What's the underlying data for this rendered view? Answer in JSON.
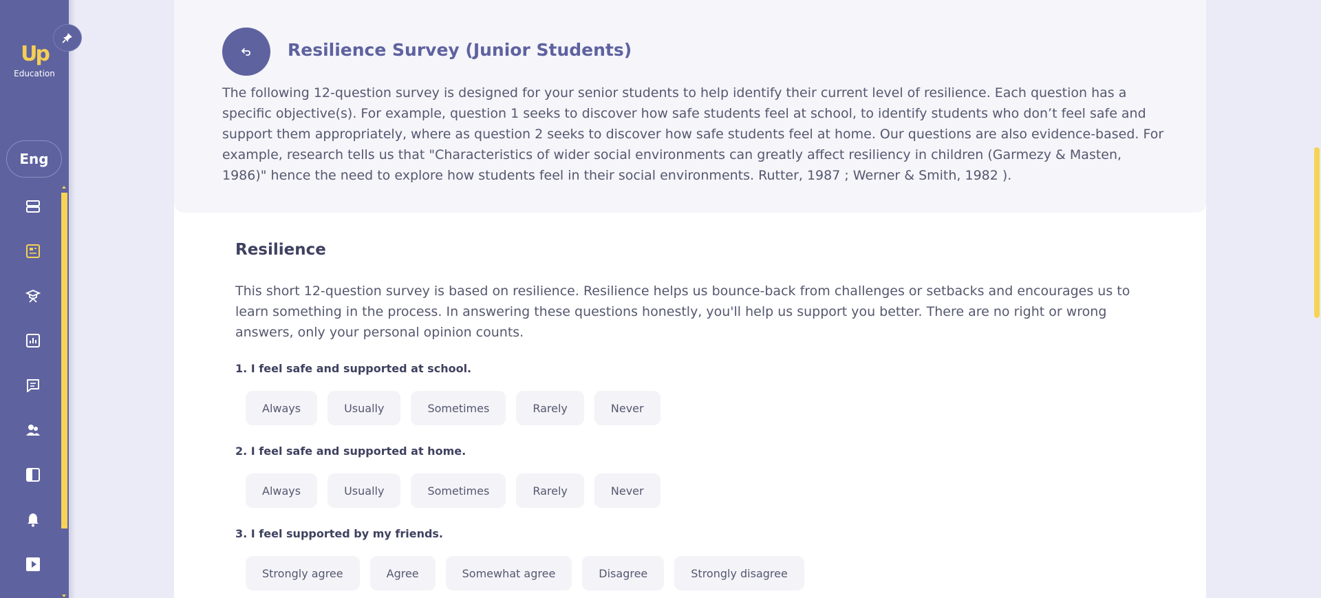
{
  "sidebar": {
    "logo_mark": "Up",
    "logo_text": "Education",
    "lang_label": "Eng",
    "nav_icons": [
      "server-icon",
      "news-icon",
      "graduate-icon",
      "chart-icon",
      "chat-icon",
      "users-icon",
      "panel-icon",
      "bell-icon",
      "video-icon"
    ]
  },
  "header": {
    "title": "Resilience Survey (Junior Students)",
    "intro": "The following 12-question survey is designed for your senior students to help identify their current level of resilience. Each question has a specific objective(s). For example, question 1 seeks to discover how safe students feel at school, to identify students who don’t feel safe and support them appropriately, where as question 2 seeks to discover how safe students feel at home. Our questions are also evidence-based. For example, research tells us that \"Characteristics of wider social environments can greatly affect resiliency in children (Garmezy & Masten, 1986)\" hence the need to explore how students feel in their social environments. Rutter, 1987 ; Werner & Smith, 1982 )."
  },
  "section": {
    "title": "Resilience",
    "description": "This short 12-question survey is based on resilience. Resilience helps us bounce-back from challenges or setbacks and encourages us to learn something in the process. In answering these questions honestly, you'll help us support you better. There are no right or wrong answers, only your personal opinion counts."
  },
  "questions": [
    {
      "label": "1. I feel safe and supported at school.",
      "options": [
        "Always",
        "Usually",
        "Sometimes",
        "Rarely",
        "Never"
      ]
    },
    {
      "label": "2. I feel safe and supported at home.",
      "options": [
        "Always",
        "Usually",
        "Sometimes",
        "Rarely",
        "Never"
      ]
    },
    {
      "label": "3. I feel supported by my friends.",
      "options": [
        "Strongly agree",
        "Agree",
        "Somewhat agree",
        "Disagree",
        "Strongly disagree"
      ]
    }
  ],
  "colors": {
    "sidebar": "#5e629f",
    "accent": "#f6d355",
    "background": "#ebebf7"
  }
}
